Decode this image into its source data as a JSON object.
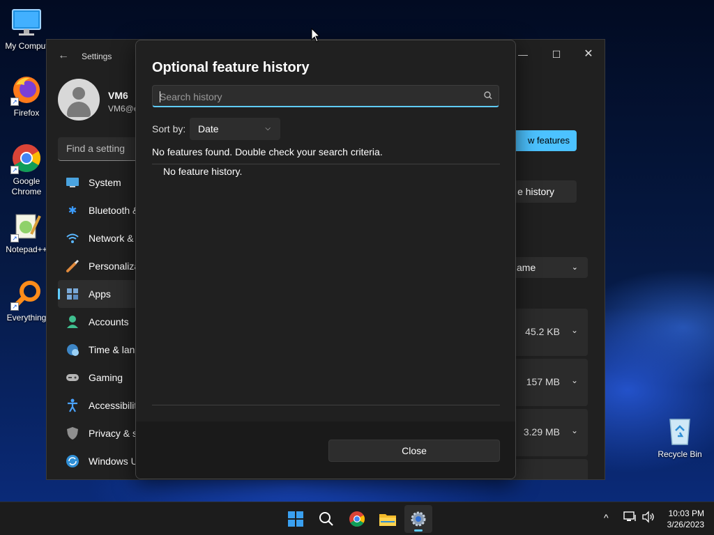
{
  "desktop": {
    "icons": [
      {
        "label": "My Comput",
        "icon": "monitor-icon"
      },
      {
        "label": "Firefox",
        "icon": "firefox-icon"
      },
      {
        "label": "Google Chrome",
        "icon": "chrome-icon"
      },
      {
        "label": "Notepad++",
        "icon": "notepadpp-icon"
      },
      {
        "label": "Everything",
        "icon": "everything-icon"
      },
      {
        "label": "Recycle Bin",
        "icon": "recycle-bin-icon"
      }
    ]
  },
  "settings": {
    "title": "Settings",
    "user": {
      "name": "VM6",
      "email": "VM6@e"
    },
    "search_placeholder": "Find a setting",
    "nav": [
      {
        "label": "System",
        "icon": "system-icon"
      },
      {
        "label": "Bluetooth &",
        "icon": "bluetooth-icon"
      },
      {
        "label": "Network &",
        "icon": "wifi-icon"
      },
      {
        "label": "Personaliza",
        "icon": "brush-icon"
      },
      {
        "label": "Apps",
        "icon": "apps-icon",
        "active": true
      },
      {
        "label": "Accounts",
        "icon": "accounts-icon"
      },
      {
        "label": "Time & lan",
        "icon": "clock-globe-icon"
      },
      {
        "label": "Gaming",
        "icon": "gamepad-icon"
      },
      {
        "label": "Accessibilit",
        "icon": "accessibility-icon"
      },
      {
        "label": "Privacy & s",
        "icon": "shield-icon"
      },
      {
        "label": "Windows U",
        "icon": "update-icon"
      }
    ],
    "right": {
      "view_features": "w features",
      "see_history": "e history",
      "sort_value": "ame",
      "sizes": [
        "45.2 KB",
        "157 MB",
        "3.29 MB"
      ]
    }
  },
  "dialog": {
    "title": "Optional feature history",
    "search_placeholder": "Search history",
    "sort_label": "Sort by:",
    "sort_value": "Date",
    "no_results": "No features found. Double check your search criteria.",
    "empty_state": "No feature history.",
    "close_label": "Close"
  },
  "taskbar": {
    "items": [
      "start-icon",
      "search-icon",
      "chrome-icon",
      "file-explorer-icon",
      "settings-gear-icon"
    ],
    "time": "10:03 PM",
    "date": "3/26/2023"
  },
  "colors": {
    "accent": "#60cdff",
    "accent_button": "#4cc2ff",
    "dialog_bg": "#202020"
  }
}
